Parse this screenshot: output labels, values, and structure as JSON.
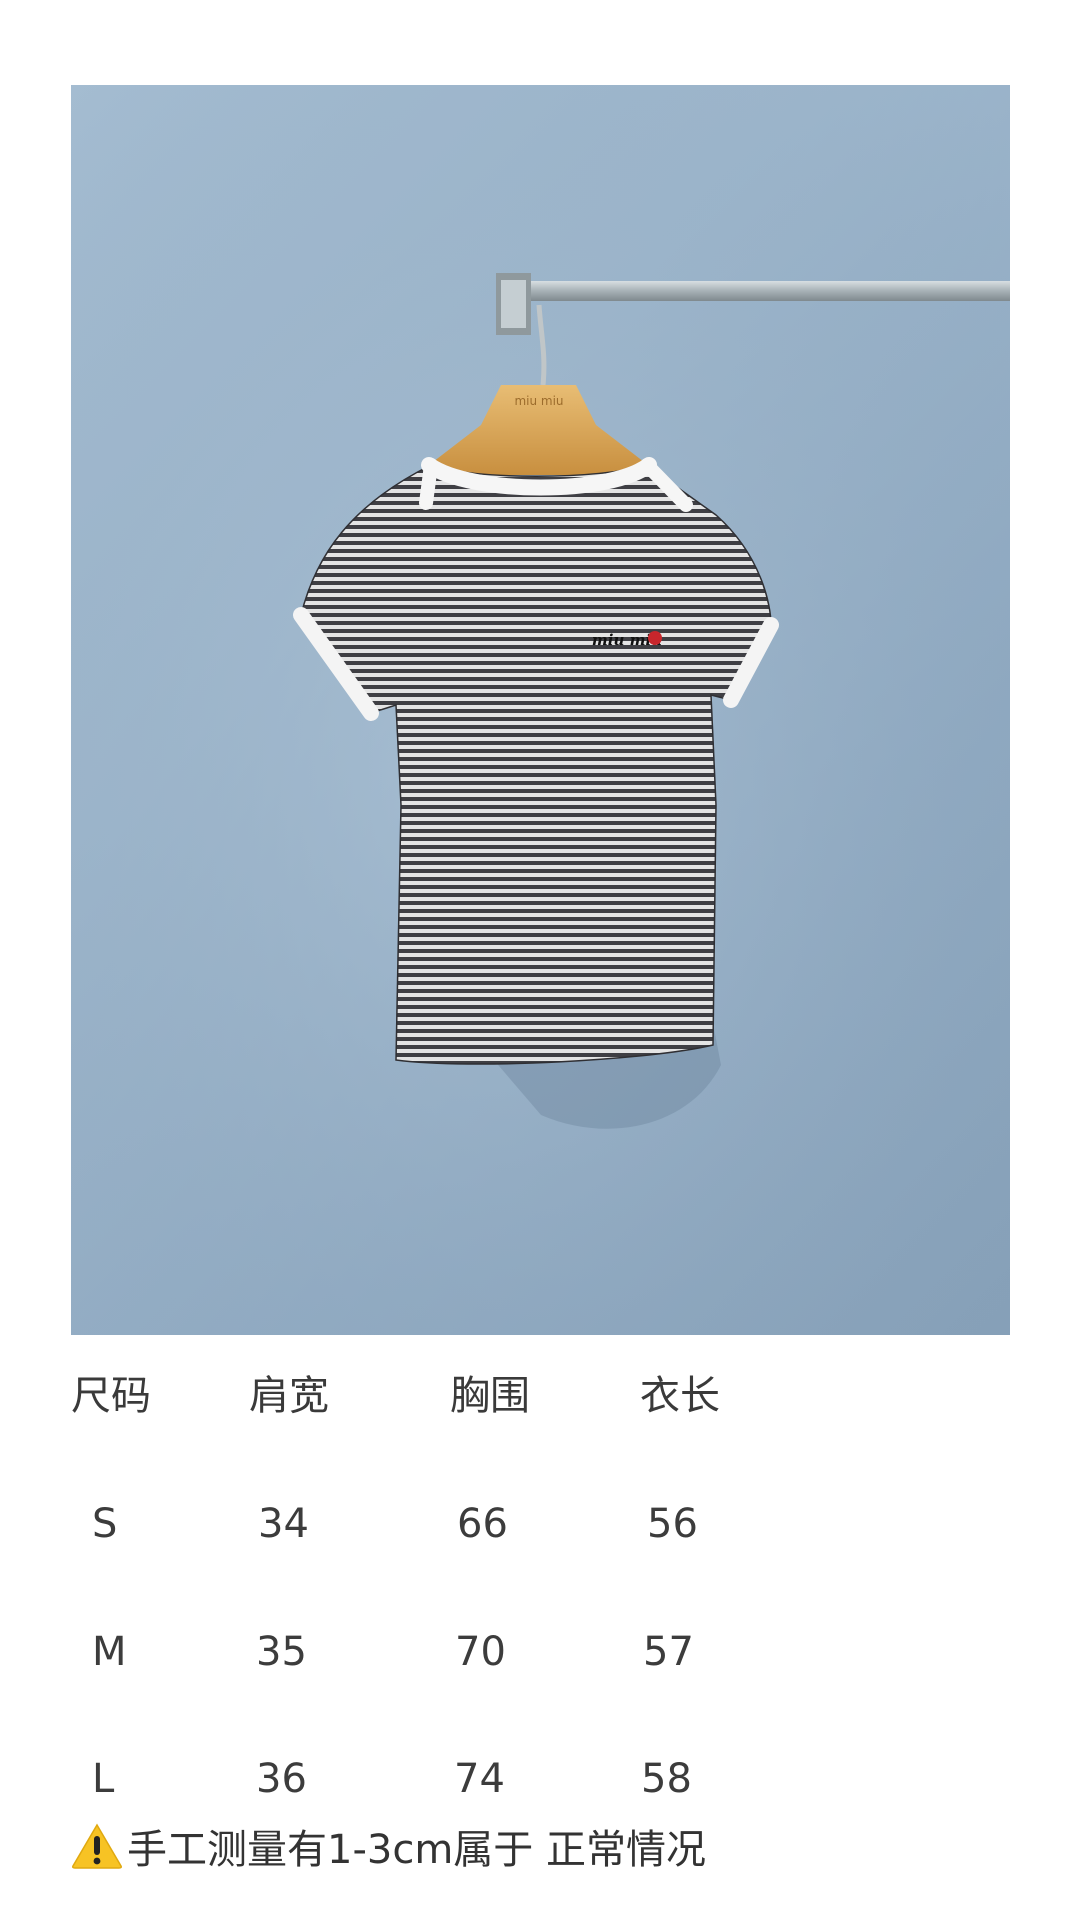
{
  "image": {
    "description_icon": "striped-tshirt-on-hanger",
    "hanger_logo_text": "miu miu",
    "embroidery_text": "miu miu",
    "colors": {
      "wall": "#9db6cc",
      "stripe_dark": "#3f3f44",
      "stripe_light": "#e6e6e6",
      "trim": "#f6f6f6",
      "hanger": "#d9a85c",
      "rail": "#b9c3c7",
      "embroidery_accent": "#c8262c"
    }
  },
  "size_table": {
    "headers": [
      "尺码",
      "肩宽",
      "胸围",
      "衣长"
    ],
    "rows": [
      [
        "S",
        "34",
        "66",
        "56"
      ],
      [
        "M",
        "35",
        "70",
        "57"
      ],
      [
        "L",
        "36",
        "74",
        "58"
      ]
    ]
  },
  "note": {
    "icon": "warning-icon",
    "text": "手工测量有1-3cm属于 正常情况"
  }
}
